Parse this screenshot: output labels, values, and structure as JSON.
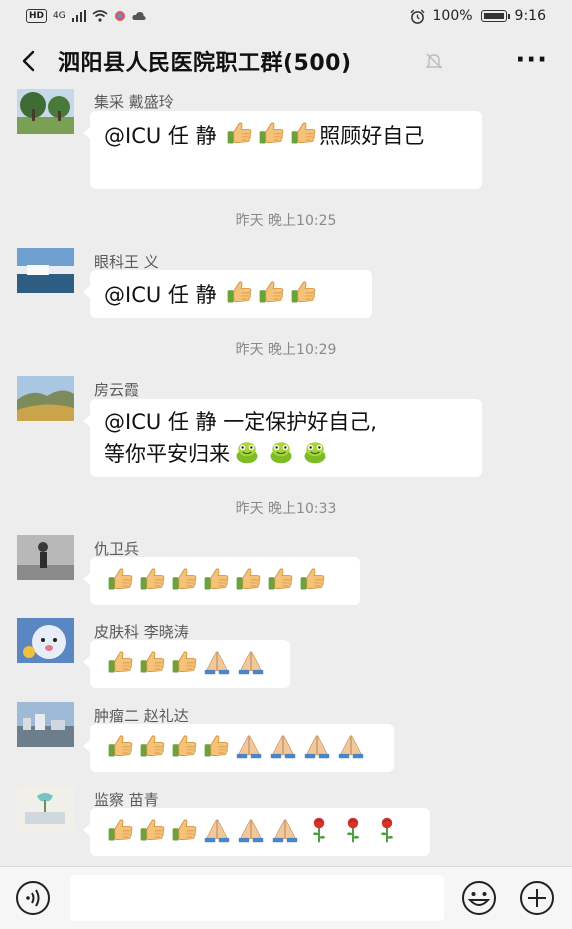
{
  "status_bar": {
    "network": "HD",
    "signal": "4G",
    "battery": "100%",
    "time": "9:16"
  },
  "header": {
    "title": "泗阳县人民医院职工群(500)",
    "more": "···"
  },
  "messages": [
    {
      "sender": "集采 戴盛玲",
      "text_before": "@ICU 任  静 ",
      "thumbs": 3,
      "text_after": "照顾好自己",
      "avatar": "avatar-park"
    },
    {
      "time": "昨天 晚上10:25"
    },
    {
      "sender": "眼科王 义",
      "text_before": "@ICU 任  静 ",
      "thumbs": 3,
      "avatar": "avatar-waterfall"
    },
    {
      "time": "昨天 晚上10:29"
    },
    {
      "sender": "房云霞",
      "line1": "@ICU 任  静  一定保护好自己,",
      "line2": "等你平安归来",
      "avatar": "avatar-mountain"
    },
    {
      "time": "昨天 晚上10:33"
    },
    {
      "sender": "仇卫兵",
      "thumbs": 7,
      "avatar": "avatar-person"
    },
    {
      "sender": "皮肤科 李晓涛",
      "thumbs": 3,
      "pray": 2,
      "avatar": "avatar-cartoon"
    },
    {
      "sender": "肿瘤二 赵礼达",
      "thumbs": 4,
      "pray": 4,
      "avatar": "avatar-city"
    },
    {
      "sender": "监察 苗青",
      "thumbs": 3,
      "pray": 3,
      "roses": 3,
      "avatar": "avatar-flower"
    }
  ],
  "colors": {
    "background": "#ededed",
    "bubble": "#ffffff",
    "sender": "#5a5a5a",
    "timestamp": "#8a8a8a"
  }
}
